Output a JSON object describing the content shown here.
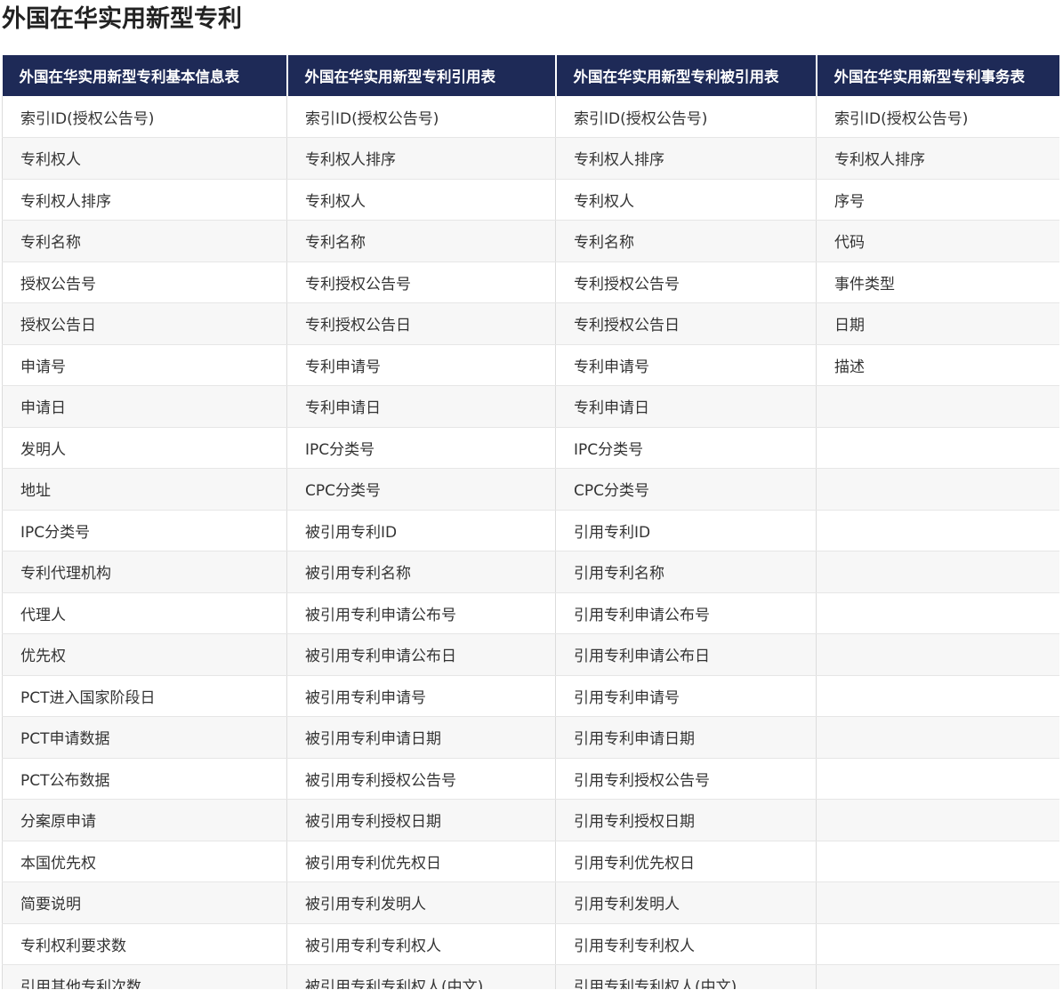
{
  "page": {
    "title": "外国在华实用新型专利"
  },
  "table": {
    "headers": [
      "外国在华实用新型专利基本信息表",
      "外国在华实用新型专利引用表",
      "外国在华实用新型专利被引用表",
      "外国在华实用新型专利事务表"
    ],
    "rows": [
      [
        "索引ID(授权公告号)",
        "索引ID(授权公告号)",
        "索引ID(授权公告号)",
        "索引ID(授权公告号)"
      ],
      [
        "专利权人",
        "专利权人排序",
        "专利权人排序",
        "专利权人排序"
      ],
      [
        "专利权人排序",
        "专利权人",
        "专利权人",
        "序号"
      ],
      [
        "专利名称",
        "专利名称",
        "专利名称",
        "代码"
      ],
      [
        "授权公告号",
        "专利授权公告号",
        "专利授权公告号",
        "事件类型"
      ],
      [
        "授权公告日",
        "专利授权公告日",
        "专利授权公告日",
        "日期"
      ],
      [
        "申请号",
        "专利申请号",
        "专利申请号",
        "描述"
      ],
      [
        "申请日",
        "专利申请日",
        "专利申请日",
        ""
      ],
      [
        "发明人",
        "IPC分类号",
        "IPC分类号",
        ""
      ],
      [
        "地址",
        "CPC分类号",
        "CPC分类号",
        ""
      ],
      [
        "IPC分类号",
        "被引用专利ID",
        "引用专利ID",
        ""
      ],
      [
        "专利代理机构",
        "被引用专利名称",
        "引用专利名称",
        ""
      ],
      [
        "代理人",
        "被引用专利申请公布号",
        "引用专利申请公布号",
        ""
      ],
      [
        "优先权",
        "被引用专利申请公布日",
        "引用专利申请公布日",
        ""
      ],
      [
        "PCT进入国家阶段日",
        "被引用专利申请号",
        "引用专利申请号",
        ""
      ],
      [
        "PCT申请数据",
        "被引用专利申请日期",
        "引用专利申请日期",
        ""
      ],
      [
        "PCT公布数据",
        "被引用专利授权公告号",
        "引用专利授权公告号",
        ""
      ],
      [
        "分案原申请",
        "被引用专利授权日期",
        "引用专利授权日期",
        ""
      ],
      [
        "本国优先权",
        "被引用专利优先权日",
        "引用专利优先权日",
        ""
      ],
      [
        "简要说明",
        "被引用专利发明人",
        "引用专利发明人",
        ""
      ],
      [
        "专利权利要求数",
        "被引用专利专利权人",
        "引用专利专利权人",
        ""
      ],
      [
        "引用其他专利次数",
        "被引用专利专利权人(中文)",
        "引用专利专利权人(中文)",
        ""
      ]
    ]
  }
}
